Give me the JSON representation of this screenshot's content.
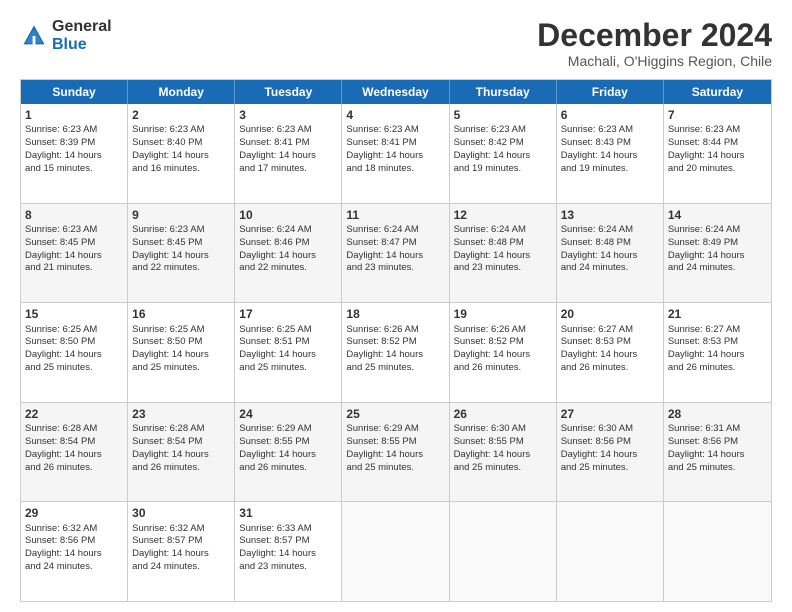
{
  "logo": {
    "general": "General",
    "blue": "Blue"
  },
  "title": "December 2024",
  "subtitle": "Machali, O'Higgins Region, Chile",
  "days": [
    "Sunday",
    "Monday",
    "Tuesday",
    "Wednesday",
    "Thursday",
    "Friday",
    "Saturday"
  ],
  "weeks": [
    [
      {
        "day": "1",
        "info": "Sunrise: 6:23 AM\nSunset: 8:39 PM\nDaylight: 14 hours\nand 15 minutes."
      },
      {
        "day": "2",
        "info": "Sunrise: 6:23 AM\nSunset: 8:40 PM\nDaylight: 14 hours\nand 16 minutes."
      },
      {
        "day": "3",
        "info": "Sunrise: 6:23 AM\nSunset: 8:41 PM\nDaylight: 14 hours\nand 17 minutes."
      },
      {
        "day": "4",
        "info": "Sunrise: 6:23 AM\nSunset: 8:41 PM\nDaylight: 14 hours\nand 18 minutes."
      },
      {
        "day": "5",
        "info": "Sunrise: 6:23 AM\nSunset: 8:42 PM\nDaylight: 14 hours\nand 19 minutes."
      },
      {
        "day": "6",
        "info": "Sunrise: 6:23 AM\nSunset: 8:43 PM\nDaylight: 14 hours\nand 19 minutes."
      },
      {
        "day": "7",
        "info": "Sunrise: 6:23 AM\nSunset: 8:44 PM\nDaylight: 14 hours\nand 20 minutes."
      }
    ],
    [
      {
        "day": "8",
        "info": "Sunrise: 6:23 AM\nSunset: 8:45 PM\nDaylight: 14 hours\nand 21 minutes."
      },
      {
        "day": "9",
        "info": "Sunrise: 6:23 AM\nSunset: 8:45 PM\nDaylight: 14 hours\nand 22 minutes."
      },
      {
        "day": "10",
        "info": "Sunrise: 6:24 AM\nSunset: 8:46 PM\nDaylight: 14 hours\nand 22 minutes."
      },
      {
        "day": "11",
        "info": "Sunrise: 6:24 AM\nSunset: 8:47 PM\nDaylight: 14 hours\nand 23 minutes."
      },
      {
        "day": "12",
        "info": "Sunrise: 6:24 AM\nSunset: 8:48 PM\nDaylight: 14 hours\nand 23 minutes."
      },
      {
        "day": "13",
        "info": "Sunrise: 6:24 AM\nSunset: 8:48 PM\nDaylight: 14 hours\nand 24 minutes."
      },
      {
        "day": "14",
        "info": "Sunrise: 6:24 AM\nSunset: 8:49 PM\nDaylight: 14 hours\nand 24 minutes."
      }
    ],
    [
      {
        "day": "15",
        "info": "Sunrise: 6:25 AM\nSunset: 8:50 PM\nDaylight: 14 hours\nand 25 minutes."
      },
      {
        "day": "16",
        "info": "Sunrise: 6:25 AM\nSunset: 8:50 PM\nDaylight: 14 hours\nand 25 minutes."
      },
      {
        "day": "17",
        "info": "Sunrise: 6:25 AM\nSunset: 8:51 PM\nDaylight: 14 hours\nand 25 minutes."
      },
      {
        "day": "18",
        "info": "Sunrise: 6:26 AM\nSunset: 8:52 PM\nDaylight: 14 hours\nand 25 minutes."
      },
      {
        "day": "19",
        "info": "Sunrise: 6:26 AM\nSunset: 8:52 PM\nDaylight: 14 hours\nand 26 minutes."
      },
      {
        "day": "20",
        "info": "Sunrise: 6:27 AM\nSunset: 8:53 PM\nDaylight: 14 hours\nand 26 minutes."
      },
      {
        "day": "21",
        "info": "Sunrise: 6:27 AM\nSunset: 8:53 PM\nDaylight: 14 hours\nand 26 minutes."
      }
    ],
    [
      {
        "day": "22",
        "info": "Sunrise: 6:28 AM\nSunset: 8:54 PM\nDaylight: 14 hours\nand 26 minutes."
      },
      {
        "day": "23",
        "info": "Sunrise: 6:28 AM\nSunset: 8:54 PM\nDaylight: 14 hours\nand 26 minutes."
      },
      {
        "day": "24",
        "info": "Sunrise: 6:29 AM\nSunset: 8:55 PM\nDaylight: 14 hours\nand 26 minutes."
      },
      {
        "day": "25",
        "info": "Sunrise: 6:29 AM\nSunset: 8:55 PM\nDaylight: 14 hours\nand 25 minutes."
      },
      {
        "day": "26",
        "info": "Sunrise: 6:30 AM\nSunset: 8:55 PM\nDaylight: 14 hours\nand 25 minutes."
      },
      {
        "day": "27",
        "info": "Sunrise: 6:30 AM\nSunset: 8:56 PM\nDaylight: 14 hours\nand 25 minutes."
      },
      {
        "day": "28",
        "info": "Sunrise: 6:31 AM\nSunset: 8:56 PM\nDaylight: 14 hours\nand 25 minutes."
      }
    ],
    [
      {
        "day": "29",
        "info": "Sunrise: 6:32 AM\nSunset: 8:56 PM\nDaylight: 14 hours\nand 24 minutes."
      },
      {
        "day": "30",
        "info": "Sunrise: 6:32 AM\nSunset: 8:57 PM\nDaylight: 14 hours\nand 24 minutes."
      },
      {
        "day": "31",
        "info": "Sunrise: 6:33 AM\nSunset: 8:57 PM\nDaylight: 14 hours\nand 23 minutes."
      },
      {
        "day": "",
        "info": ""
      },
      {
        "day": "",
        "info": ""
      },
      {
        "day": "",
        "info": ""
      },
      {
        "day": "",
        "info": ""
      }
    ]
  ]
}
